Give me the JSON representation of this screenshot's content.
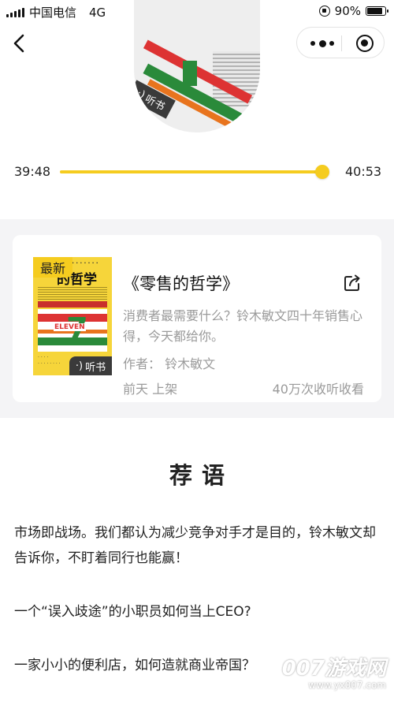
{
  "status_bar": {
    "carrier": "中国电信",
    "network": "4G",
    "time": "下午5:04",
    "battery": "90%",
    "battery_level": 0.9
  },
  "nav": {
    "title": "零售的哲学",
    "back_icon": "chevron-left-icon",
    "more_icon": "more-dots-icon",
    "close_icon": "target-circle-icon"
  },
  "player": {
    "elapsed": "39:48",
    "total": "40:53",
    "progress_fraction": 0.974,
    "accent_color": "#f5cc1f",
    "cover_tag": "听书"
  },
  "book": {
    "badge": "最新",
    "cover_title": "的哲学",
    "cover_tag": "听书",
    "title": "《零售的哲学》",
    "description": "消费者最需要什么？铃木敏文四十年销售心得，今天都给你。",
    "author": "作者：  铃木敏文",
    "updated": "前天 上架",
    "plays": "40万次收听收看",
    "share_icon": "share-icon"
  },
  "recommend": {
    "title": "荐语",
    "paragraphs": [
      "市场即战场。我们都认为减少竞争对手才是目的，铃木敏文却告诉你，不盯着同行也能赢！",
      "一个“误入歧途”的小职员如何当上CEO?",
      "一家小小的便利店，如何造就商业帝国？"
    ]
  },
  "watermark": {
    "logo": "007游戏网",
    "url": "www.yx007.com"
  }
}
